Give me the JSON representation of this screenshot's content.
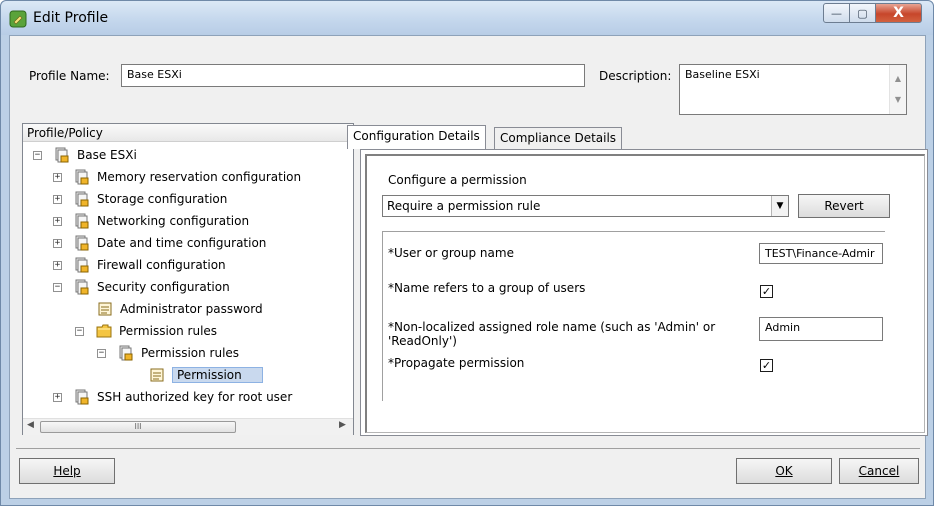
{
  "window": {
    "title": "Edit Profile",
    "close_glyph": "X",
    "min_glyph": "—",
    "max_glyph": "▢"
  },
  "header": {
    "profile_name_label": "Profile Name:",
    "profile_name_value": "Base ESXi",
    "description_label": "Description:",
    "description_value": "Baseline ESXi"
  },
  "tree": {
    "header": "Profile/Policy",
    "items": [
      {
        "label": "Base ESXi",
        "expander": "−",
        "icon": "profile-icon"
      },
      {
        "label": "Memory reservation configuration",
        "expander": "+",
        "icon": "profile-icon"
      },
      {
        "label": "Storage configuration",
        "expander": "+",
        "icon": "profile-icon"
      },
      {
        "label": "Networking configuration",
        "expander": "+",
        "icon": "profile-icon"
      },
      {
        "label": "Date and time configuration",
        "expander": "+",
        "icon": "profile-icon"
      },
      {
        "label": "Firewall configuration",
        "expander": "+",
        "icon": "profile-icon"
      },
      {
        "label": "Security configuration",
        "expander": "−",
        "icon": "profile-icon"
      },
      {
        "label": "Administrator password",
        "expander": "",
        "icon": "policy-icon"
      },
      {
        "label": "Permission rules",
        "expander": "−",
        "icon": "folder-icon"
      },
      {
        "label": "Permission rules",
        "expander": "−",
        "icon": "profile-icon"
      },
      {
        "label": "Permission",
        "expander": "",
        "icon": "policy-icon",
        "selected": true
      },
      {
        "label": "SSH authorized key for root user",
        "expander": "+",
        "icon": "profile-icon"
      }
    ],
    "hscroll_thumb_glyph": "III"
  },
  "tabs": [
    {
      "label": "Configuration Details",
      "active": true
    },
    {
      "label": "Compliance Details",
      "active": false
    }
  ],
  "config": {
    "section_title": "Configure a permission",
    "dropdown_value": "Require a permission rule",
    "revert_label": "Revert",
    "properties": [
      {
        "label": "*User or group name",
        "type": "text",
        "value": "TEST\\Finance-Admir"
      },
      {
        "label": "*Name refers to a group of users",
        "type": "checkbox",
        "checked": true
      },
      {
        "label": "*Non-localized assigned role name (such as 'Admin' or 'ReadOnly')",
        "type": "text",
        "value": "Admin"
      },
      {
        "label": "*Propagate permission",
        "type": "checkbox",
        "checked": true
      }
    ]
  },
  "footer": {
    "help_label": "Help",
    "ok_label": "OK",
    "cancel_label": "Cancel"
  },
  "colors": {
    "window_frame": "#bcd0e6",
    "close_button": "#c7462b",
    "selection": "#c9d9ee"
  }
}
